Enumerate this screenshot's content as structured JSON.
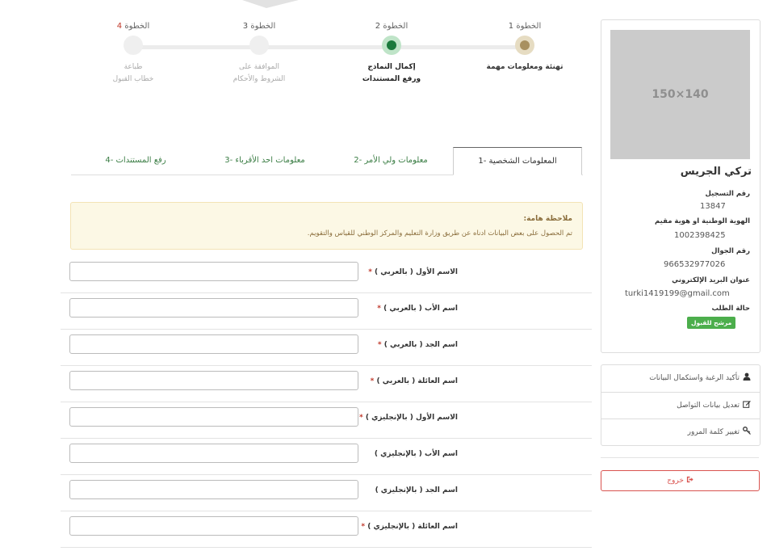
{
  "stepper": {
    "steps": [
      {
        "prefix": "الخطوة",
        "num": "1",
        "label": "تهنئة ومعلومات مهمة",
        "state": "done",
        "dot_color": "#a89060"
      },
      {
        "prefix": "الخطوة",
        "num": "2",
        "label": "إكمال النماذج ورفع المستندات",
        "label_line1": "إكمال النماذج",
        "label_line2": "ورفع المستندات",
        "state": "active",
        "dot_color": "#1a7a3c"
      },
      {
        "prefix": "الخطوة",
        "num": "3",
        "label_line1": "الموافقة على",
        "label_line2": "الشروط والأحكام",
        "state": "pending"
      },
      {
        "prefix": "الخطوة",
        "num": "4",
        "label_line1": "طباعة",
        "label_line2": "خطاب القبول",
        "state": "pending"
      }
    ]
  },
  "tabs": [
    {
      "label": "1- المعلومات الشخصية",
      "active": true
    },
    {
      "label": "2- معلومات ولي الأمر",
      "active": false
    },
    {
      "label": "3- معلومات احد الأقرباء",
      "active": false
    },
    {
      "label": "4- رفع المستندات",
      "active": false
    }
  ],
  "note": {
    "title": "ملاحظة هامة:",
    "text": "تم الحصول على بعض البيانات ادناه عن طريق وزارة التعليم والمركز الوطني للقياس والتقويم."
  },
  "form": {
    "fields": [
      {
        "label": "الاسم الأول ( بالعربي )",
        "required": true,
        "value": ""
      },
      {
        "label": "اسم الأب ( بالعربي )",
        "required": true,
        "value": ""
      },
      {
        "label": "اسم الجد ( بالعربي )",
        "required": true,
        "value": ""
      },
      {
        "label": "اسم العائلة ( بالعربي )",
        "required": true,
        "value": ""
      },
      {
        "label": "الاسم الأول ( بالإنجليزي )",
        "required": true,
        "value": ""
      },
      {
        "label": "اسم الأب ( بالإنجليزي )",
        "required": false,
        "value": ""
      },
      {
        "label": "اسم الجد ( بالإنجليزي )",
        "required": false,
        "value": ""
      },
      {
        "label": "اسم العائلة ( بالإنجليزي )",
        "required": true,
        "value": ""
      }
    ]
  },
  "profile": {
    "photo_placeholder": "150×140",
    "name": "تركي الجريس",
    "reg_label": "رقم التسجيل",
    "reg_value": "13847",
    "id_label": "الهوية الوطنية او هوية مقيم",
    "id_value": "1002398425",
    "mobile_label": "رقم الجوال",
    "mobile_value": "966532977026",
    "email_label": "عنوان البريد الإلكتروني",
    "email_value": "turki1419199@gmail.com",
    "status_label": "حالة الطلب",
    "status_value": "مرشح للقبول",
    "status_color": "#4cae4c"
  },
  "menu": {
    "items": [
      {
        "label": "تأكيد الرغبة واستكمال البيانات",
        "icon": "user-icon"
      },
      {
        "label": "تعديل بيانات التواصل",
        "icon": "edit-icon"
      },
      {
        "label": "تغيير كلمة المرور",
        "icon": "key-icon"
      }
    ]
  },
  "logout_label": "خروج",
  "required_mark": "*"
}
